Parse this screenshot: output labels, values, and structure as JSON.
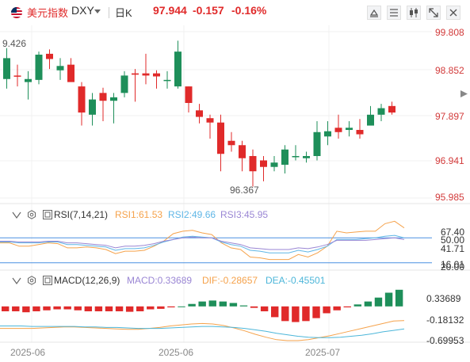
{
  "header": {
    "name": "美元指数",
    "symbol": "DXY",
    "period": "日K",
    "price": "97.944",
    "change": "-0.157",
    "change_pct": "-0.16%"
  },
  "colors": {
    "up": "#1e8f5a",
    "down": "#e02a2a",
    "name": "#e02a2a",
    "neg": "#e02a2a",
    "axis_red": "#d23a3a",
    "rsi1": "#f5a24b",
    "rsi2": "#5fb6e6",
    "rsi3": "#9a86d4",
    "dif": "#f5a24b",
    "dea": "#4cb6d9"
  },
  "price_axis": [
    "99.808",
    "98.852",
    "97.897",
    "96.941",
    "95.985"
  ],
  "price_annotations": {
    "high": "9.426",
    "low": "96.367"
  },
  "rsi": {
    "title": "RSI(7,14,21)",
    "rsi1": "RSI1:61.53",
    "rsi2": "RSI2:49.66",
    "rsi3": "RSI3:45.95",
    "axis": [
      "67.40",
      "50.00",
      "41.71",
      "20.00",
      "16.01"
    ]
  },
  "macd": {
    "title": "MACD(12,26,9)",
    "macd": "MACD:0.33689",
    "dif": "DIF:-0.28657",
    "dea": "DEA:-0.45501",
    "axis": [
      "0.33689",
      "-0.18132",
      "-0.69953"
    ]
  },
  "x_axis": [
    "2025-06",
    "2025-06",
    "2025-07"
  ],
  "chart_data": [
    {
      "type": "candlestick",
      "title": "DXY 日K",
      "ylim": [
        95.985,
        99.808
      ],
      "yticks": [
        99.808,
        98.852,
        97.897,
        96.941,
        95.985
      ],
      "candles": [
        {
          "o": 98.72,
          "h": 99.43,
          "l": 98.5,
          "c": 99.2
        },
        {
          "o": 98.8,
          "h": 99.05,
          "l": 98.55,
          "c": 98.78
        },
        {
          "o": 98.65,
          "h": 98.9,
          "l": 98.25,
          "c": 98.72
        },
        {
          "o": 98.7,
          "h": 99.35,
          "l": 98.6,
          "c": 99.28
        },
        {
          "o": 99.3,
          "h": 99.4,
          "l": 98.95,
          "c": 99.18
        },
        {
          "o": 98.92,
          "h": 99.2,
          "l": 98.7,
          "c": 99.02
        },
        {
          "o": 99.05,
          "h": 99.2,
          "l": 98.7,
          "c": 98.65
        },
        {
          "o": 98.55,
          "h": 98.65,
          "l": 97.65,
          "c": 97.95
        },
        {
          "o": 97.9,
          "h": 98.4,
          "l": 97.65,
          "c": 98.25
        },
        {
          "o": 98.4,
          "h": 98.52,
          "l": 97.75,
          "c": 98.22
        },
        {
          "o": 98.22,
          "h": 98.4,
          "l": 97.7,
          "c": 98.3
        },
        {
          "o": 98.4,
          "h": 98.9,
          "l": 98.3,
          "c": 98.8
        },
        {
          "o": 98.85,
          "h": 98.95,
          "l": 98.2,
          "c": 98.82
        },
        {
          "o": 98.85,
          "h": 99.3,
          "l": 98.6,
          "c": 98.8
        },
        {
          "o": 98.85,
          "h": 98.92,
          "l": 98.5,
          "c": 98.78
        },
        {
          "o": 98.7,
          "h": 98.9,
          "l": 98.5,
          "c": 98.7
        },
        {
          "o": 98.55,
          "h": 99.6,
          "l": 98.5,
          "c": 99.35
        },
        {
          "o": 98.55,
          "h": 98.55,
          "l": 97.95,
          "c": 98.17
        },
        {
          "o": 98.0,
          "h": 98.15,
          "l": 97.7,
          "c": 97.85
        },
        {
          "o": 97.82,
          "h": 97.9,
          "l": 97.35,
          "c": 97.72
        },
        {
          "o": 97.72,
          "h": 97.9,
          "l": 96.6,
          "c": 97.0
        },
        {
          "o": 97.3,
          "h": 97.5,
          "l": 97.05,
          "c": 97.2
        },
        {
          "o": 97.2,
          "h": 97.3,
          "l": 96.6,
          "c": 96.9
        },
        {
          "o": 96.95,
          "h": 97.1,
          "l": 96.25,
          "c": 96.6
        },
        {
          "o": 96.85,
          "h": 96.95,
          "l": 96.37,
          "c": 96.7
        },
        {
          "o": 96.7,
          "h": 96.95,
          "l": 96.6,
          "c": 96.8
        },
        {
          "o": 96.75,
          "h": 97.2,
          "l": 96.55,
          "c": 97.1
        },
        {
          "o": 96.95,
          "h": 97.2,
          "l": 96.85,
          "c": 96.95
        },
        {
          "o": 96.9,
          "h": 97.05,
          "l": 96.8,
          "c": 96.95
        },
        {
          "o": 96.95,
          "h": 97.75,
          "l": 96.85,
          "c": 97.5
        },
        {
          "o": 97.4,
          "h": 97.75,
          "l": 97.2,
          "c": 97.52
        },
        {
          "o": 97.6,
          "h": 97.9,
          "l": 97.35,
          "c": 97.5
        },
        {
          "o": 97.55,
          "h": 97.75,
          "l": 97.4,
          "c": 97.6
        },
        {
          "o": 97.55,
          "h": 97.8,
          "l": 97.35,
          "c": 97.45
        },
        {
          "o": 97.65,
          "h": 98.1,
          "l": 97.65,
          "c": 97.9
        },
        {
          "o": 97.9,
          "h": 98.15,
          "l": 97.75,
          "c": 98.05
        },
        {
          "o": 98.1,
          "h": 98.2,
          "l": 97.9,
          "c": 97.95
        }
      ]
    },
    {
      "type": "line",
      "title": "RSI(7,14,21)",
      "ylim": [
        16.01,
        67.4
      ],
      "series": [
        {
          "name": "RSI1",
          "values": [
            44,
            44,
            40,
            40,
            42,
            44,
            43,
            38,
            38,
            39,
            38,
            36,
            31,
            34,
            34,
            35,
            40,
            46,
            55,
            58,
            59,
            56,
            54,
            44,
            38,
            36,
            27,
            26,
            24,
            24,
            24,
            30,
            27,
            32,
            40,
            58,
            56,
            57,
            58,
            58,
            67,
            70,
            62
          ]
        },
        {
          "name": "RSI2",
          "values": [
            45,
            45,
            44,
            44,
            44,
            45,
            45,
            42,
            42,
            41,
            40,
            39,
            35,
            37,
            37,
            38,
            41,
            45,
            48,
            51,
            52,
            51,
            50,
            45,
            42,
            40,
            35,
            34,
            32,
            32,
            32,
            35,
            33,
            36,
            40,
            48,
            48,
            48,
            49,
            50,
            52,
            53,
            50
          ]
        },
        {
          "name": "RSI3",
          "values": [
            46,
            46,
            45,
            45,
            45,
            46,
            46,
            44,
            44,
            43,
            42,
            41,
            38,
            40,
            40,
            41,
            43,
            46,
            48,
            50,
            51,
            50,
            50,
            46,
            44,
            42,
            38,
            37,
            36,
            36,
            36,
            38,
            37,
            39,
            42,
            47,
            47,
            47,
            47,
            48,
            49,
            50,
            48
          ]
        }
      ]
    },
    {
      "type": "bar+line",
      "title": "MACD(12,26,9)",
      "ylim": [
        -0.69953,
        0.33689
      ],
      "series": [
        {
          "name": "MACD",
          "values": [
            -0.1,
            -0.1,
            -0.12,
            -0.1,
            -0.08,
            -0.06,
            -0.06,
            -0.08,
            -0.1,
            -0.1,
            -0.1,
            -0.1,
            -0.11,
            -0.1,
            -0.06,
            -0.05,
            -0.02,
            0.0,
            0.05,
            0.1,
            0.12,
            0.1,
            0.07,
            0.02,
            -0.03,
            -0.1,
            -0.22,
            -0.3,
            -0.32,
            -0.3,
            -0.24,
            -0.14,
            -0.08,
            -0.02,
            0.04,
            0.1,
            0.18,
            0.28,
            0.34
          ]
        },
        {
          "name": "DIF",
          "values": [
            -0.45,
            -0.45,
            -0.45,
            -0.45,
            -0.44,
            -0.43,
            -0.42,
            -0.42,
            -0.43,
            -0.44,
            -0.45,
            -0.46,
            -0.47,
            -0.47,
            -0.45,
            -0.43,
            -0.4,
            -0.38,
            -0.36,
            -0.35,
            -0.36,
            -0.39,
            -0.44,
            -0.5,
            -0.57,
            -0.63,
            -0.68,
            -0.7,
            -0.7,
            -0.68,
            -0.64,
            -0.6,
            -0.55,
            -0.5,
            -0.45,
            -0.4,
            -0.35,
            -0.3,
            -0.29
          ]
        },
        {
          "name": "DEA",
          "values": [
            -0.4,
            -0.4,
            -0.4,
            -0.41,
            -0.41,
            -0.41,
            -0.41,
            -0.41,
            -0.42,
            -0.42,
            -0.43,
            -0.43,
            -0.44,
            -0.45,
            -0.45,
            -0.45,
            -0.44,
            -0.43,
            -0.42,
            -0.41,
            -0.41,
            -0.42,
            -0.43,
            -0.45,
            -0.48,
            -0.51,
            -0.55,
            -0.58,
            -0.61,
            -0.63,
            -0.64,
            -0.64,
            -0.63,
            -0.61,
            -0.59,
            -0.56,
            -0.52,
            -0.49,
            -0.46
          ]
        }
      ]
    }
  ]
}
